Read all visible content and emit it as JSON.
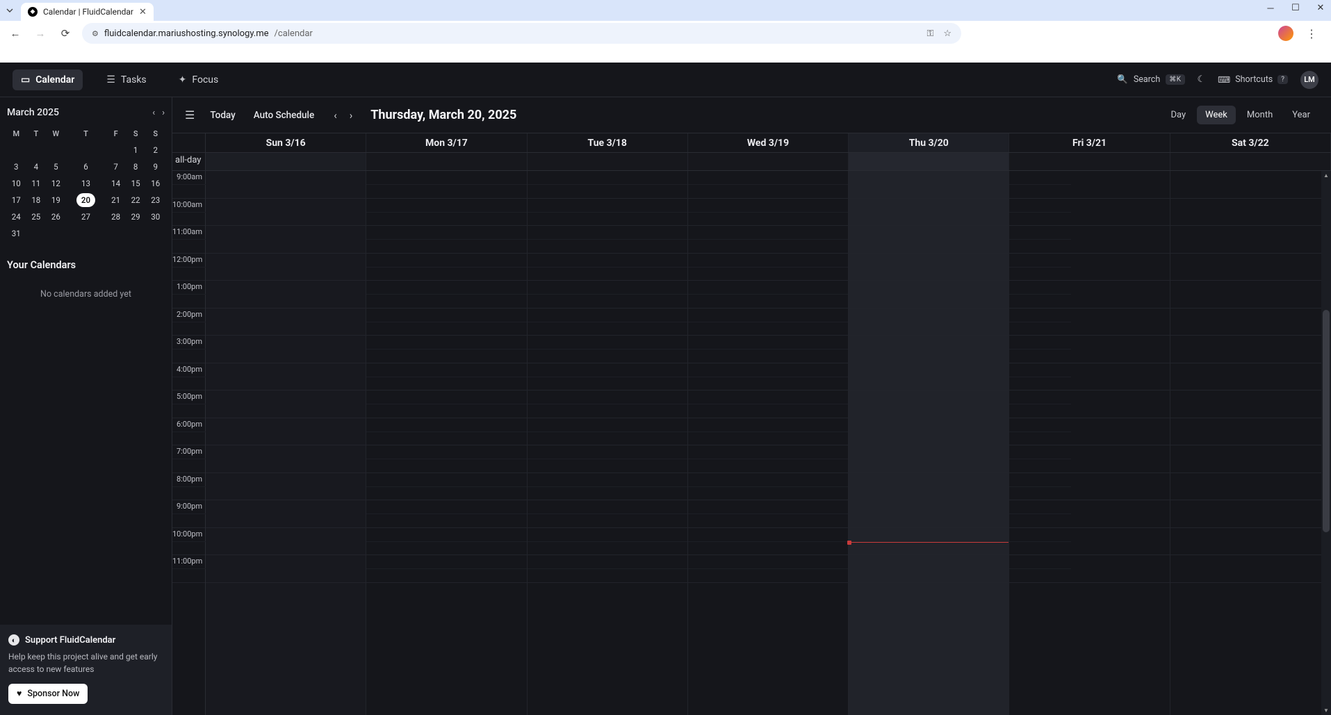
{
  "browser": {
    "tab_title": "Calendar | FluidCalendar",
    "url_host": "fluidcalendar.mariushosting.synology.me",
    "url_path": "/calendar"
  },
  "topnav": {
    "calendar": "Calendar",
    "tasks": "Tasks",
    "focus": "Focus",
    "search": "Search",
    "search_kbd": "⌘K",
    "shortcuts": "Shortcuts",
    "shortcuts_kbd": "?",
    "avatar": "LM"
  },
  "toolbar": {
    "today": "Today",
    "auto_schedule": "Auto Schedule",
    "date_title": "Thursday, March 20, 2025",
    "views": {
      "day": "Day",
      "week": "Week",
      "month": "Month",
      "year": "Year"
    }
  },
  "mini_cal": {
    "title": "March 2025",
    "dow": [
      "M",
      "T",
      "W",
      "T",
      "F",
      "S",
      "S"
    ],
    "weeks": [
      [
        "",
        "",
        "",
        "",
        "",
        "1",
        "2"
      ],
      [
        "3",
        "4",
        "5",
        "6",
        "7",
        "8",
        "9"
      ],
      [
        "10",
        "11",
        "12",
        "13",
        "14",
        "15",
        "16"
      ],
      [
        "17",
        "18",
        "19",
        "20",
        "21",
        "22",
        "23"
      ],
      [
        "24",
        "25",
        "26",
        "27",
        "28",
        "29",
        "30"
      ],
      [
        "31",
        "",
        "",
        "",
        "",
        "",
        ""
      ]
    ],
    "today": "20"
  },
  "sidebar": {
    "your_calendars": "Your Calendars",
    "empty": "No calendars added yet",
    "support_title": "Support FluidCalendar",
    "support_text": "Help keep this project alive and get early access to new features",
    "sponsor": "Sponsor Now"
  },
  "week": {
    "allday": "all-day",
    "days": [
      "Sun 3/16",
      "Mon 3/17",
      "Tue 3/18",
      "Wed 3/19",
      "Thu 3/20",
      "Fri 3/21",
      "Sat 3/22"
    ],
    "today_index": 4,
    "times": [
      "9:00am",
      "10:00am",
      "11:00am",
      "12:00pm",
      "1:00pm",
      "2:00pm",
      "3:00pm",
      "4:00pm",
      "5:00pm",
      "6:00pm",
      "7:00pm",
      "8:00pm",
      "9:00pm",
      "10:00pm",
      "11:00pm"
    ]
  }
}
